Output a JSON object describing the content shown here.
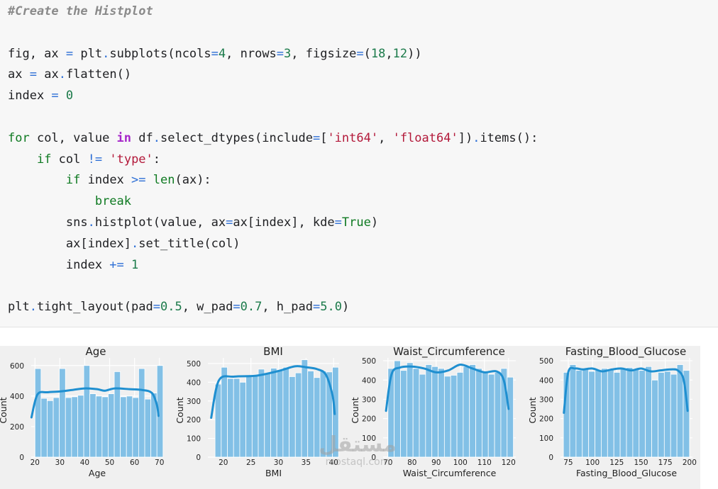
{
  "code": {
    "lines": [
      [
        [
          "#Create the Histplot",
          "#8a8a8a",
          "italic"
        ]
      ],
      [],
      [
        [
          "fig, ax ",
          "#202124"
        ],
        [
          "=",
          "#2d6fd6"
        ],
        [
          " plt",
          "#202124"
        ],
        [
          ".",
          "#2d6fd6"
        ],
        [
          "subplots(ncols",
          "#202124"
        ],
        [
          "=",
          "#2d6fd6"
        ],
        [
          "4",
          "#1b7a4a"
        ],
        [
          ", nrows",
          "#202124"
        ],
        [
          "=",
          "#2d6fd6"
        ],
        [
          "3",
          "#1b7a4a"
        ],
        [
          ", figsize",
          "#202124"
        ],
        [
          "=",
          "#2d6fd6"
        ],
        [
          "(",
          "#202124"
        ],
        [
          "18",
          "#1b7a4a"
        ],
        [
          ",",
          "#202124"
        ],
        [
          "12",
          "#1b7a4a"
        ],
        [
          "))",
          "#202124"
        ]
      ],
      [
        [
          "ax ",
          "#202124"
        ],
        [
          "=",
          "#2d6fd6"
        ],
        [
          " ax",
          "#202124"
        ],
        [
          ".",
          "#2d6fd6"
        ],
        [
          "flatten()",
          "#202124"
        ]
      ],
      [
        [
          "index ",
          "#202124"
        ],
        [
          "=",
          "#2d6fd6"
        ],
        [
          " ",
          "#202124"
        ],
        [
          "0",
          "#1b7a4a"
        ]
      ],
      [],
      [
        [
          "for",
          "#0f7a22"
        ],
        [
          " col, value ",
          "#202124"
        ],
        [
          "in",
          "#a626c9",
          "bold"
        ],
        [
          " df",
          "#202124"
        ],
        [
          ".",
          "#2d6fd6"
        ],
        [
          "select_dtypes(include",
          "#202124"
        ],
        [
          "=",
          "#2d6fd6"
        ],
        [
          "[",
          "#202124"
        ],
        [
          "'int64'",
          "#b3193a"
        ],
        [
          ", ",
          "#202124"
        ],
        [
          "'float64'",
          "#b3193a"
        ],
        [
          "])",
          "#202124"
        ],
        [
          ".",
          "#2d6fd6"
        ],
        [
          "items():",
          "#202124"
        ]
      ],
      [
        [
          "    ",
          "#202124"
        ],
        [
          "if",
          "#0f7a22"
        ],
        [
          " col ",
          "#202124"
        ],
        [
          "!=",
          "#2d6fd6"
        ],
        [
          " ",
          "#202124"
        ],
        [
          "'type'",
          "#b3193a"
        ],
        [
          ":",
          "#202124"
        ]
      ],
      [
        [
          "        ",
          "#202124"
        ],
        [
          "if",
          "#0f7a22"
        ],
        [
          " index ",
          "#202124"
        ],
        [
          ">=",
          "#2d6fd6"
        ],
        [
          " ",
          "#202124"
        ],
        [
          "len",
          "#0f7a22"
        ],
        [
          "(ax):",
          "#202124"
        ]
      ],
      [
        [
          "            ",
          "#202124"
        ],
        [
          "break",
          "#0f7a22"
        ]
      ],
      [
        [
          "        sns",
          "#202124"
        ],
        [
          ".",
          "#2d6fd6"
        ],
        [
          "histplot(value, ax",
          "#202124"
        ],
        [
          "=",
          "#2d6fd6"
        ],
        [
          "ax[index], kde",
          "#202124"
        ],
        [
          "=",
          "#2d6fd6"
        ],
        [
          "True",
          "#0f7a22"
        ],
        [
          ")",
          "#202124"
        ]
      ],
      [
        [
          "        ax[index]",
          "#202124"
        ],
        [
          ".",
          "#2d6fd6"
        ],
        [
          "set_title(col)",
          "#202124"
        ]
      ],
      [
        [
          "        index ",
          "#202124"
        ],
        [
          "+=",
          "#2d6fd6"
        ],
        [
          " ",
          "#202124"
        ],
        [
          "1",
          "#1b7a4a"
        ]
      ],
      [],
      [
        [
          "plt",
          "#202124"
        ],
        [
          ".",
          "#2d6fd6"
        ],
        [
          "tight_layout(pad",
          "#202124"
        ],
        [
          "=",
          "#2d6fd6"
        ],
        [
          "0.5",
          "#1b7a4a"
        ],
        [
          ", w_pad",
          "#202124"
        ],
        [
          "=",
          "#2d6fd6"
        ],
        [
          "0.7",
          "#1b7a4a"
        ],
        [
          ", h_pad",
          "#202124"
        ],
        [
          "=",
          "#2d6fd6"
        ],
        [
          "5.0",
          "#1b7a4a"
        ],
        [
          ")",
          "#202124"
        ]
      ]
    ]
  },
  "colors": {
    "bar_fill": "#82c0e6",
    "bar_edge": "#ffffff",
    "kde": "#1f8fd0",
    "panel_bg": "#f0f0f0",
    "grid": "#ffffff",
    "text": "#222222"
  },
  "chart_data": [
    {
      "type": "bar",
      "title": "Age",
      "xlabel": "Age",
      "ylabel": "Count",
      "xlim": [
        18.5,
        71.5
      ],
      "ylim": [
        0,
        650
      ],
      "xticks": [
        20,
        30,
        40,
        50,
        60,
        70
      ],
      "yticks": [
        0,
        200,
        400,
        600
      ],
      "bins": [
        20,
        22.45,
        24.9,
        27.35,
        29.8,
        32.25,
        34.7,
        37.15,
        39.6,
        42.05,
        44.5,
        46.95,
        49.4,
        51.85,
        54.3,
        56.75,
        59.2,
        61.65,
        64.1,
        66.55,
        69
      ],
      "values": [
        580,
        385,
        370,
        390,
        580,
        390,
        395,
        405,
        600,
        415,
        400,
        395,
        415,
        560,
        395,
        400,
        390,
        580,
        380,
        420,
        600
      ],
      "kde": [
        [
          18.6,
          260
        ],
        [
          21,
          410
        ],
        [
          25,
          425
        ],
        [
          30,
          430
        ],
        [
          35,
          440
        ],
        [
          40,
          450
        ],
        [
          45,
          445
        ],
        [
          48,
          435
        ],
        [
          52,
          450
        ],
        [
          58,
          445
        ],
        [
          63,
          440
        ],
        [
          67,
          420
        ],
        [
          69,
          340
        ],
        [
          69.6,
          270
        ]
      ]
    },
    {
      "type": "bar",
      "title": "BMI",
      "xlabel": "BMI",
      "ylabel": "Count",
      "xlim": [
        17.2,
        41
      ],
      "ylim": [
        0,
        530
      ],
      "xticks": [
        20,
        25,
        30,
        35,
        40
      ],
      "yticks": [
        0,
        100,
        200,
        300,
        400,
        500
      ],
      "bins": [
        18.5,
        19.62,
        20.74,
        21.86,
        22.98,
        24.1,
        25.22,
        26.34,
        27.46,
        28.58,
        29.7,
        30.82,
        31.94,
        33.06,
        34.18,
        35.3,
        36.42,
        37.54,
        38.66,
        39.78
      ],
      "values": [
        390,
        480,
        420,
        420,
        400,
        430,
        440,
        470,
        445,
        475,
        465,
        480,
        430,
        450,
        520,
        460,
        425,
        460,
        455,
        480
      ],
      "kde": [
        [
          17.8,
          210
        ],
        [
          19.2,
          410
        ],
        [
          22,
          430
        ],
        [
          26,
          435
        ],
        [
          30,
          460
        ],
        [
          33,
          485
        ],
        [
          35,
          480
        ],
        [
          37,
          470
        ],
        [
          38.6,
          440
        ],
        [
          39.8,
          330
        ],
        [
          40.2,
          230
        ]
      ]
    },
    {
      "type": "bar",
      "title": "Waist_Circumference",
      "xlabel": "Waist_Circumference",
      "ylabel": "Count",
      "xlim": [
        68,
        123
      ],
      "ylim": [
        0,
        515
      ],
      "xticks": [
        70,
        80,
        90,
        100,
        110,
        120
      ],
      "yticks": [
        0,
        100,
        200,
        300,
        400,
        500
      ],
      "bins": [
        70,
        72.6,
        75.2,
        77.8,
        80.4,
        83,
        85.6,
        88.2,
        90.8,
        93.4,
        96,
        98.6,
        101.2,
        103.8,
        106.4,
        109,
        111.6,
        114.2,
        116.8,
        119.4
      ],
      "values": [
        460,
        500,
        450,
        490,
        460,
        430,
        480,
        470,
        460,
        420,
        425,
        440,
        470,
        480,
        460,
        440,
        430,
        440,
        460,
        415
      ],
      "kde": [
        [
          69.2,
          240
        ],
        [
          71.5,
          430
        ],
        [
          75,
          465
        ],
        [
          80,
          470
        ],
        [
          85,
          460
        ],
        [
          90,
          440
        ],
        [
          95,
          450
        ],
        [
          100,
          480
        ],
        [
          105,
          460
        ],
        [
          110,
          440
        ],
        [
          115,
          445
        ],
        [
          118,
          400
        ],
        [
          120,
          250
        ]
      ]
    },
    {
      "type": "bar",
      "title": "Fasting_Blood_Glucose",
      "xlabel": "Fasting_Blood_Glucose",
      "ylabel": "Count",
      "xlim": [
        67,
        203
      ],
      "ylim": [
        0,
        515
      ],
      "xticks": [
        75,
        100,
        125,
        150,
        175,
        200
      ],
      "yticks": [
        0,
        100,
        200,
        300,
        400,
        500
      ],
      "bins": [
        70,
        76.5,
        83,
        89.5,
        96,
        102.5,
        109,
        115.5,
        122,
        128.5,
        135,
        141.5,
        148,
        154.5,
        161,
        167.5,
        174,
        180.5,
        187,
        193.5
      ],
      "values": [
        440,
        480,
        450,
        460,
        445,
        450,
        460,
        455,
        440,
        460,
        465,
        455,
        450,
        470,
        400,
        440,
        445,
        430,
        480,
        450
      ],
      "kde": [
        [
          70.5,
          230
        ],
        [
          75,
          440
        ],
        [
          82,
          460
        ],
        [
          90,
          455
        ],
        [
          100,
          460
        ],
        [
          110,
          445
        ],
        [
          120,
          455
        ],
        [
          130,
          460
        ],
        [
          140,
          450
        ],
        [
          150,
          460
        ],
        [
          160,
          445
        ],
        [
          170,
          450
        ],
        [
          180,
          455
        ],
        [
          188,
          450
        ],
        [
          194,
          400
        ],
        [
          198,
          240
        ]
      ]
    }
  ]
}
